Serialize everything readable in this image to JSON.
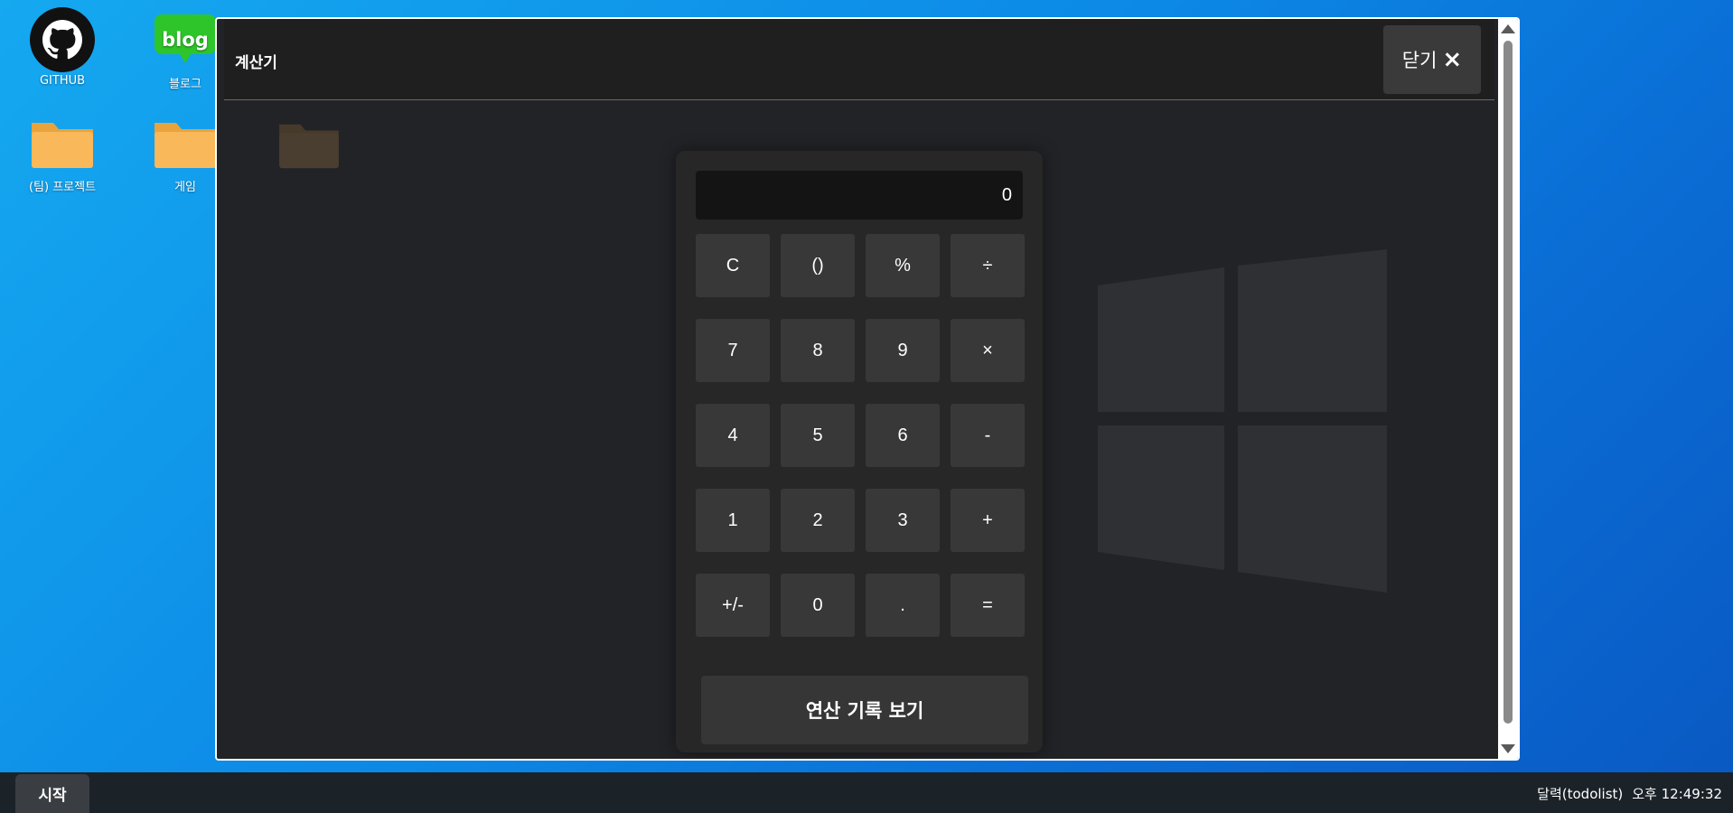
{
  "desktop": {
    "icons": [
      {
        "label": "GITHUB",
        "icon": "github-icon"
      },
      {
        "label": "블로그",
        "icon": "blog-icon",
        "badge": "blog"
      },
      {
        "label": "(팀) 프로젝트",
        "icon": "folder-icon"
      },
      {
        "label": "게임",
        "icon": "folder-icon"
      }
    ]
  },
  "modal": {
    "title": "계산기",
    "close_label": "닫기",
    "close_icon": "×"
  },
  "calculator": {
    "display": "0",
    "keys": [
      "C",
      "()",
      "%",
      "÷",
      "7",
      "8",
      "9",
      "×",
      "4",
      "5",
      "6",
      "-",
      "1",
      "2",
      "3",
      "+",
      "+/-",
      "0",
      ".",
      "="
    ],
    "history_label": "연산 기록 보기"
  },
  "taskbar": {
    "start_label": "시작",
    "app_status": "달력(todolist)",
    "clock": "오후 12:49:32"
  },
  "colors": {
    "desktop_blue": "#0c89e6",
    "modal_bg": "#222327",
    "calc_bg": "#272727",
    "key_bg": "#383838",
    "taskbar_bg": "#1b2228"
  }
}
